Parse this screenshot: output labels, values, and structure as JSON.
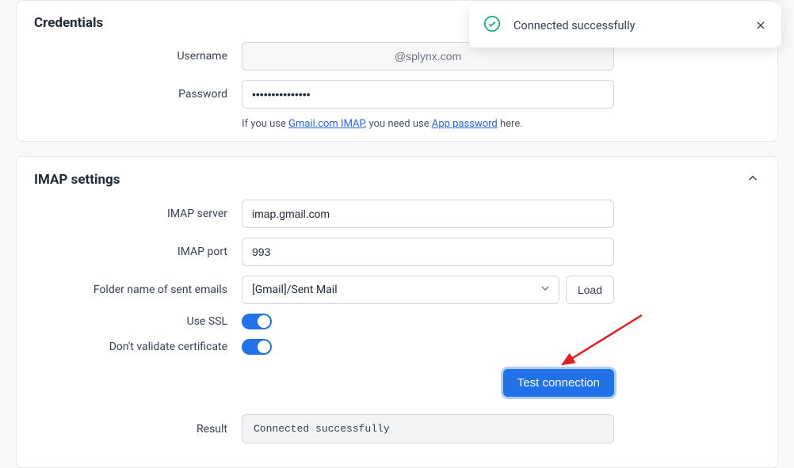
{
  "toast": {
    "message": "Connected successfully"
  },
  "credentials": {
    "title": "Credentials",
    "username_label": "Username",
    "username_value": "@splynx.com",
    "password_label": "Password",
    "password_value": "•••••••••••••••",
    "helper_prefix": "If you use ",
    "helper_link1": "Gmail.com IMAP",
    "helper_mid": ", you need use ",
    "helper_link2": "App password",
    "helper_suffix": " here."
  },
  "imap": {
    "title": "IMAP settings",
    "server_label": "IMAP server",
    "server_value": "imap.gmail.com",
    "port_label": "IMAP port",
    "port_value": "993",
    "folder_label": "Folder name of sent emails",
    "folder_value": "[Gmail]/Sent Mail",
    "load_label": "Load",
    "ssl_label": "Use SSL",
    "validate_label": "Don't validate certificate",
    "test_label": "Test connection",
    "result_label": "Result",
    "result_value": "Connected successfully"
  }
}
